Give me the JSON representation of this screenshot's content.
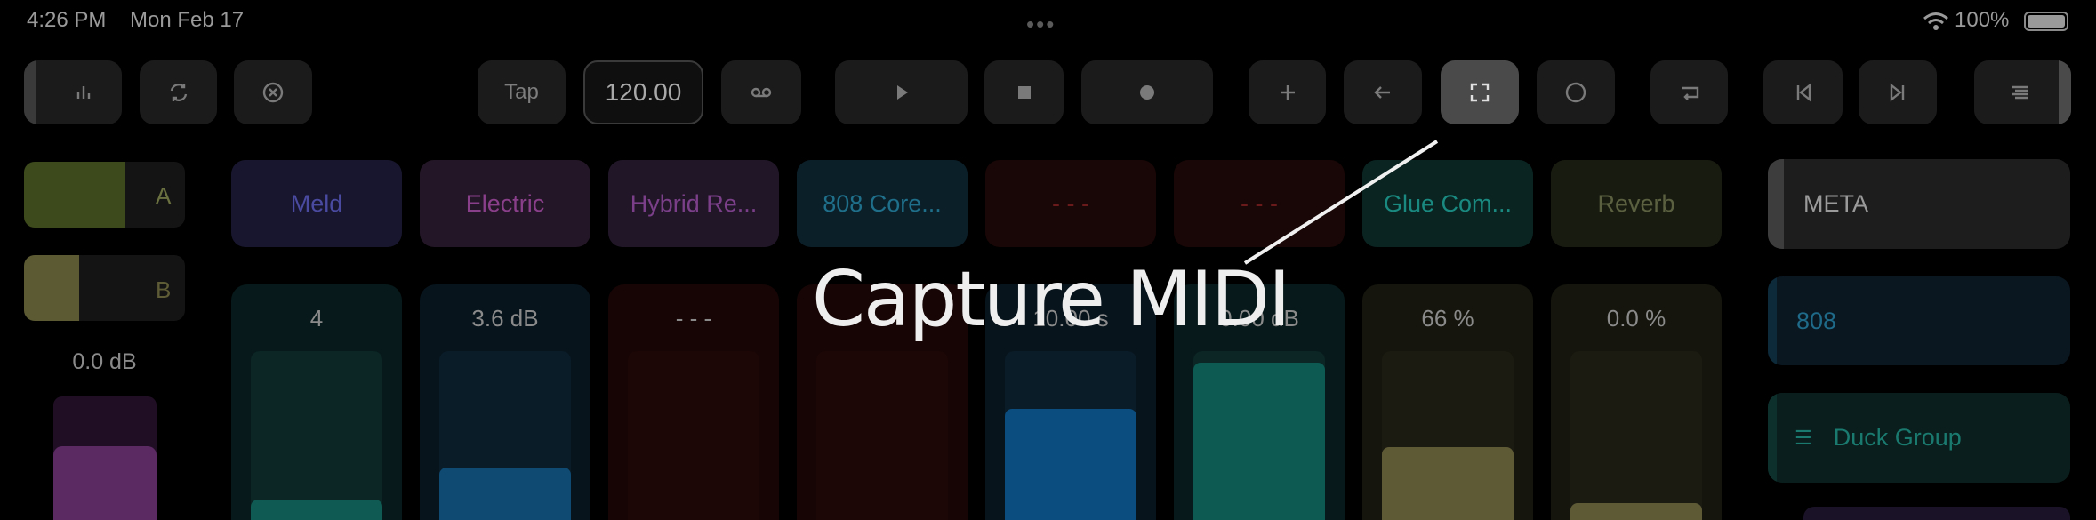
{
  "status_bar": {
    "time": "4:26 PM",
    "date": "Mon Feb 17",
    "battery": "100%"
  },
  "toolbar": {
    "tap_label": "Tap",
    "tempo": "120.00"
  },
  "crossfader": {
    "a_label": "A",
    "b_label": "B",
    "a_level": 0.7,
    "b_level": 0.35,
    "master_db": "0.0 dB",
    "master_level": 0.6
  },
  "devices": [
    {
      "label": "Meld",
      "color": "#4a4aa0",
      "bg": "#17162e"
    },
    {
      "label": "Electric",
      "color": "#8a3f8a",
      "bg": "#231626"
    },
    {
      "label": "Hybrid Re...",
      "color": "#7a3f88",
      "bg": "#201628"
    },
    {
      "label": "808 Core...",
      "color": "#1f6f8a",
      "bg": "#0b1f29"
    },
    {
      "label": "- - -",
      "color": "#6a1a1a",
      "bg": "#190606"
    },
    {
      "label": "- - -",
      "color": "#6a1a1a",
      "bg": "#190606"
    },
    {
      "label": "Glue Com...",
      "color": "#1a8a80",
      "bg": "#0a2422"
    },
    {
      "label": "Reverb",
      "color": "#5a6040",
      "bg": "#181b10"
    }
  ],
  "parameters": [
    {
      "value": "4",
      "level": 0.12,
      "color": "#0f5a52",
      "col_bg": "#07191a",
      "well_bg": "#0b2624"
    },
    {
      "value": "3.6 dB",
      "level": 0.31,
      "color": "#0e4a72",
      "col_bg": "#07141c",
      "well_bg": "#0a1c28"
    },
    {
      "value": "- - -",
      "level": 0,
      "color": "#3a0a0a",
      "col_bg": "#170505",
      "well_bg": "#1d0606"
    },
    {
      "value": "",
      "level": 0,
      "color": "#3a0a0a",
      "col_bg": "#170505",
      "well_bg": "#1d0606"
    },
    {
      "value": "10.00 s",
      "level": 0.66,
      "color": "#0b4d7e",
      "col_bg": "#07141c",
      "well_bg": "#0a1c28"
    },
    {
      "value": "0.00 dB",
      "level": 0.93,
      "color": "#0c5a52",
      "col_bg": "#07191a",
      "well_bg": "#0b2624"
    },
    {
      "value": "66 %",
      "level": 0.43,
      "color": "#5e5a36",
      "col_bg": "#15150d",
      "well_bg": "#1b1b12"
    },
    {
      "value": "0.0 %",
      "level": 0.1,
      "color": "#5e5a36",
      "col_bg": "#15150d",
      "well_bg": "#1b1b12"
    }
  ],
  "right_panel": {
    "meta_label": "META",
    "slot_808": "808",
    "duck_group": "Duck Group"
  },
  "callout": {
    "text": "Capture MIDI"
  }
}
